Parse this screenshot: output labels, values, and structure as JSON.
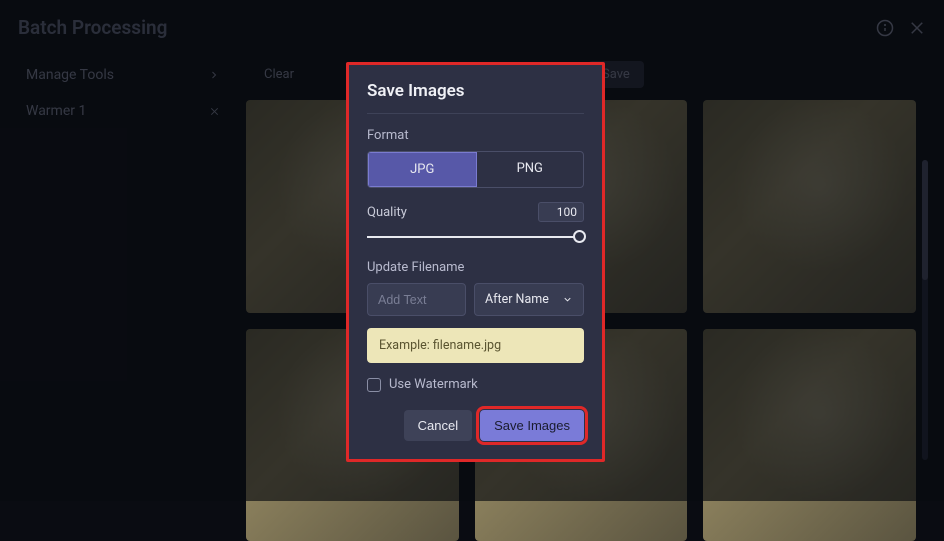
{
  "header": {
    "title": "Batch Processing"
  },
  "sidebar": {
    "manage_label": "Manage Tools",
    "items": [
      {
        "label": "Warmer 1"
      }
    ]
  },
  "toolbar": {
    "clear_label": "Clear",
    "save_label": "Save"
  },
  "modal": {
    "title": "Save Images",
    "format_label": "Format",
    "format_jpg": "JPG",
    "format_png": "PNG",
    "quality_label": "Quality",
    "quality_value": "100",
    "update_filename_label": "Update Filename",
    "add_text_placeholder": "Add Text",
    "position_selected": "After Name",
    "example_text": "Example: filename.jpg",
    "watermark_label": "Use Watermark",
    "cancel_label": "Cancel",
    "save_label": "Save Images"
  }
}
